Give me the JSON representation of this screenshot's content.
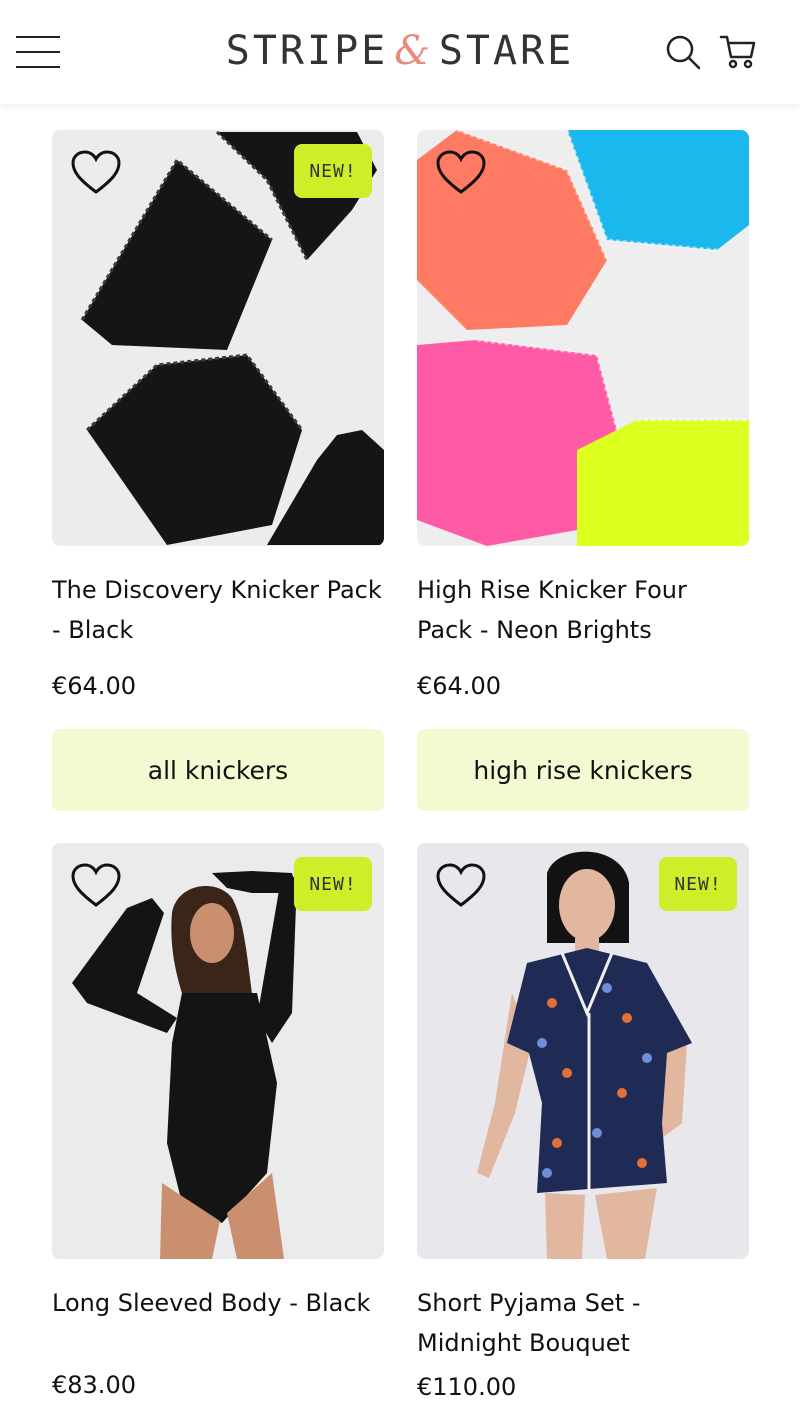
{
  "header": {
    "logo_left": "STRIPE",
    "logo_amp": "&",
    "logo_right": "STARE",
    "menu_icon": "hamburger-menu-icon",
    "search_icon": "search-icon",
    "cart_icon": "shopping-cart-icon"
  },
  "colors": {
    "badge": "#ccef2a",
    "tag_button": "#f1fad0",
    "logo_accent": "#e88a7c"
  },
  "products": [
    {
      "title": "The Discovery Knicker Pack - Black",
      "price": "€64.00",
      "badge": "NEW!",
      "tag": "all knickers",
      "image": "black lace knickers on grey background"
    },
    {
      "title": "High Rise Knicker Four Pack - Neon Brights",
      "price": "€64.00",
      "badge": "",
      "tag": "high rise knickers",
      "image": "coral, blue, pink and neon yellow knickers"
    },
    {
      "title": "Long Sleeved Body - Black",
      "price": "€83.00",
      "badge": "NEW!",
      "tag": "",
      "image": "model wearing black long sleeved body"
    },
    {
      "title": "Short Pyjama Set - Midnight Bouquet",
      "price": "€110.00",
      "badge": "NEW!",
      "tag": "",
      "image": "model wearing navy floral short pyjama set"
    }
  ]
}
